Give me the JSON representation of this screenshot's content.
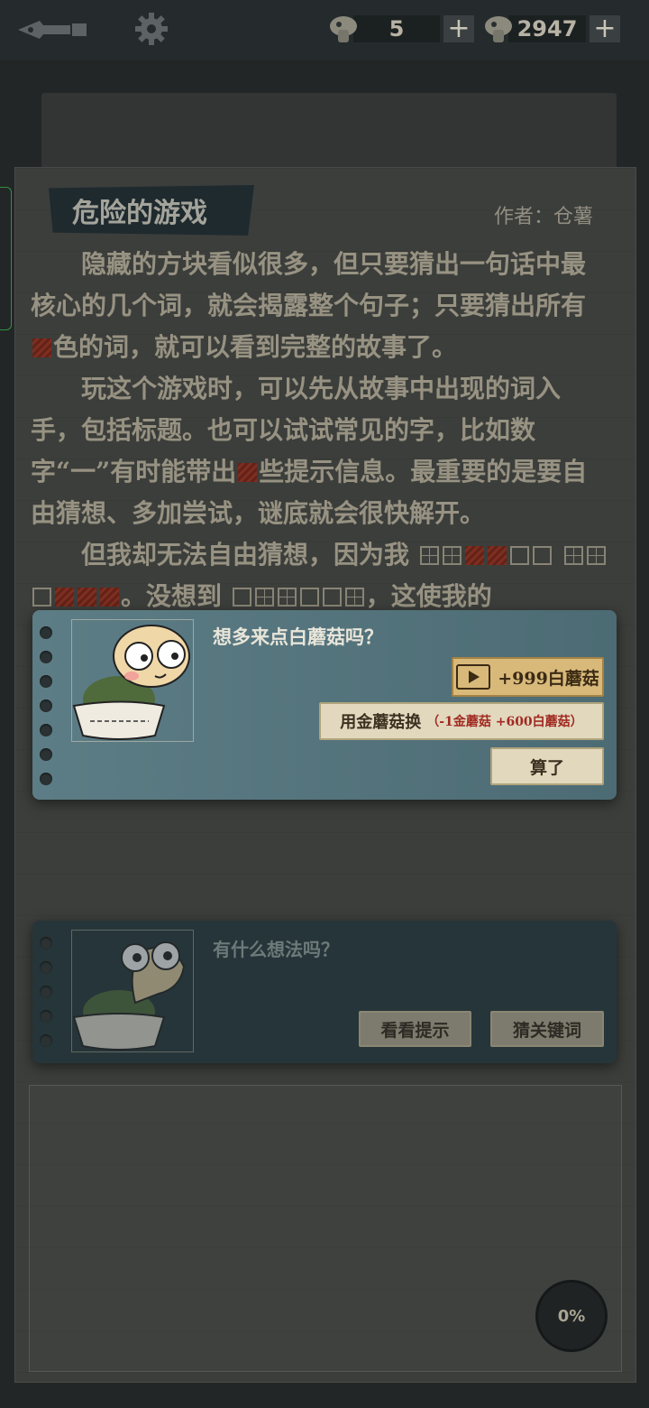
{
  "topbar": {
    "gold_mushroom_count": "5",
    "white_mushroom_count": "2947",
    "plus": "+"
  },
  "story": {
    "title": "危险的游戏",
    "author": "作者：仓薯",
    "p1": "隐藏的方块看似很多，但只要猜出一句话中最核心的几个词，就会揭露整个句子；只要猜出所有",
    "p1b": "色的词，就可以看到完整的故事了。",
    "p2": "玩这个游戏时，可以先从故事中出现的词入手，包括标题。也可以试试常见的字，比如数字“一”有时能带出",
    "p2b": "些提示信息。最重要的是要自由猜想、多加尝试，谜底就会很快解开。",
    "p3a": "但我却无法自由猜想，因为我",
    "p3b": "。没想到",
    "p3c": "，这使我的"
  },
  "modal": {
    "question": "想多来点白蘑菇吗？",
    "video_button": "+999白蘑菇",
    "gold_button": "用金蘑菇换",
    "gold_hint": "（-1金蘑菇 +600白蘑菇）",
    "cancel_button": "算了"
  },
  "thoughts": {
    "question": "有什么想法吗？",
    "hint_button": "看看提示",
    "guess_button": "猜关键词"
  },
  "progress": "0%",
  "colors": {
    "accent_gold": "#d8b97a",
    "modal_bg": "#5d7d86",
    "hidden_red": "#8a3222"
  }
}
